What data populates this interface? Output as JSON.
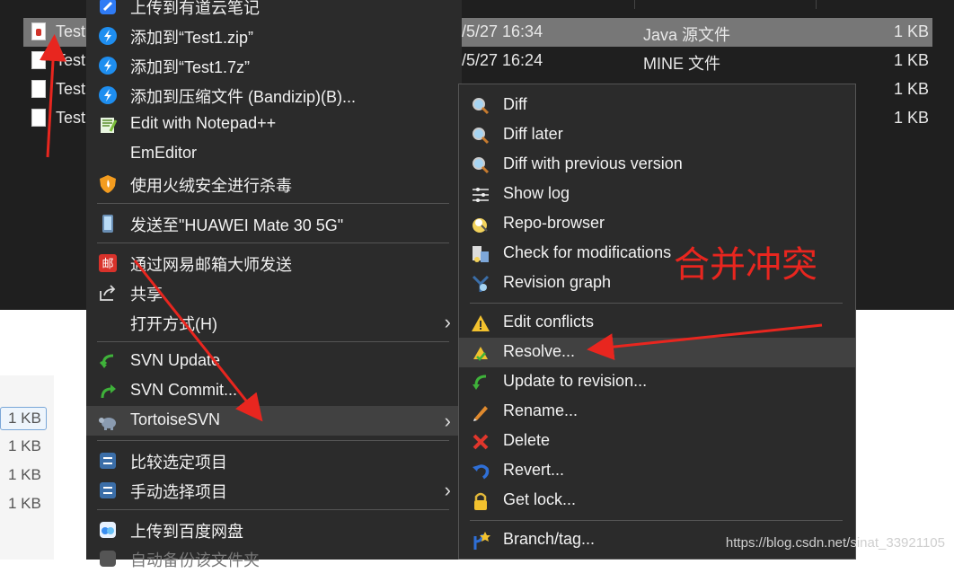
{
  "explorer": {
    "files": [
      {
        "name": "Test",
        "date": "/5/27 16:34",
        "type": "Java 源文件",
        "size": "1 KB",
        "selected": true
      },
      {
        "name": "Test",
        "date": "/5/27 16:24",
        "type": "MINE 文件",
        "size": "1 KB"
      },
      {
        "name": "Test",
        "date": "",
        "type": "",
        "size": "1 KB"
      },
      {
        "name": "Test",
        "date": "",
        "type": "",
        "size": "1 KB"
      }
    ],
    "light_sizes": [
      "1 KB",
      "1 KB",
      "1 KB",
      "1 KB"
    ]
  },
  "context_menu": {
    "items": [
      {
        "label": "上传到有道云笔记",
        "icon": "youdao-note-icon"
      },
      {
        "label": "添加到“Test1.zip”",
        "icon": "bandizip-icon"
      },
      {
        "label": "添加到“Test1.7z”",
        "icon": "bandizip-icon"
      },
      {
        "label": "添加到压缩文件 (Bandizip)(B)...",
        "icon": "bandizip-icon"
      },
      {
        "label": "Edit with Notepad++",
        "icon": "notepad-plus-plus-icon"
      },
      {
        "label": "EmEditor",
        "icon": ""
      },
      {
        "label": "使用火绒安全进行杀毒",
        "icon": "huorong-shield-icon"
      },
      {
        "label": "发送至\"HUAWEI Mate 30 5G\"",
        "icon": "phone-icon"
      },
      {
        "label": "通过网易邮箱大师发送",
        "icon": "netease-mail-icon"
      },
      {
        "label": "共享",
        "icon": "share-icon"
      },
      {
        "label": "打开方式(H)",
        "icon": ""
      },
      {
        "label": "SVN Update",
        "icon": "svn-update-icon"
      },
      {
        "label": "SVN Commit...",
        "icon": "svn-commit-icon"
      },
      {
        "label": "TortoiseSVN",
        "icon": "tortoisesvn-icon"
      },
      {
        "label": "比较选定项目",
        "icon": "compare-icon"
      },
      {
        "label": "手动选择项目",
        "icon": "compare-icon"
      },
      {
        "label": "上传到百度网盘",
        "icon": "baidu-netdisk-icon"
      },
      {
        "label": "自动备份该文件夹",
        "icon": ""
      }
    ]
  },
  "svn_submenu": {
    "items": [
      {
        "label": "Diff",
        "icon": "magnifier-icon"
      },
      {
        "label": "Diff later",
        "icon": "magnifier-icon"
      },
      {
        "label": "Diff with previous version",
        "icon": "magnifier-icon"
      },
      {
        "label": "Show log",
        "icon": "log-icon"
      },
      {
        "label": "Repo-browser",
        "icon": "repo-browser-icon"
      },
      {
        "label": "Check for modifications",
        "icon": "check-modifications-icon"
      },
      {
        "label": "Revision graph",
        "icon": "revision-graph-icon"
      },
      {
        "label": "Edit conflicts",
        "icon": "conflict-warning-icon"
      },
      {
        "label": "Resolve...",
        "icon": "resolve-icon"
      },
      {
        "label": "Update to revision...",
        "icon": "update-revision-icon"
      },
      {
        "label": "Rename...",
        "icon": "rename-pencil-icon"
      },
      {
        "label": "Delete",
        "icon": "delete-x-icon"
      },
      {
        "label": "Revert...",
        "icon": "revert-icon"
      },
      {
        "label": "Get lock...",
        "icon": "lock-icon"
      },
      {
        "label": "Branch/tag...",
        "icon": "branch-tag-icon"
      }
    ]
  },
  "annotation": {
    "text": "合并冲突",
    "color": "#e8261f"
  },
  "watermark": "https://blog.csdn.net/sinat_33921105"
}
